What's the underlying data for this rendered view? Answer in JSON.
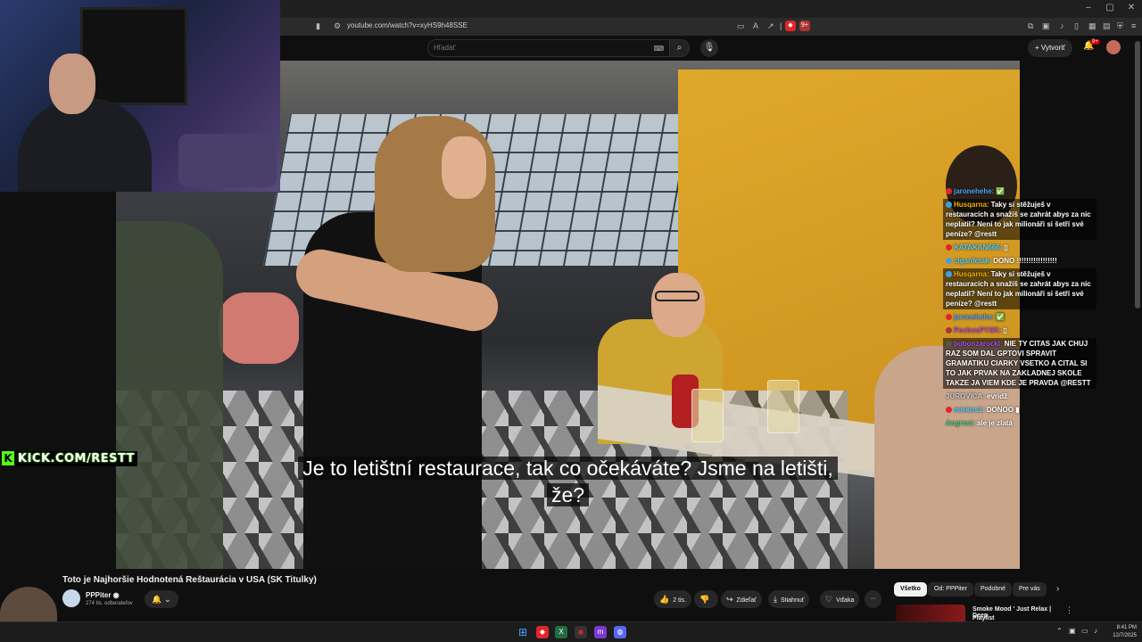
{
  "browser": {
    "url": "youtube.com/watch?v=xyHS9h48SSE",
    "notification_badge": "9+",
    "window_controls": [
      "–",
      "▢",
      "✕"
    ]
  },
  "youtube_header": {
    "search_placeholder": "Hľadať",
    "create_label": "Vytvoriť",
    "notification_count": "9+"
  },
  "video": {
    "subtitle_line1": "Je to letištní restaurace, tak co očekáváte? Jsme na letišti,",
    "subtitle_line2": "že?"
  },
  "overlay": {
    "kick_handle": "KICK.COM/RESTT",
    "kick_letter": "K"
  },
  "chat": [
    {
      "user": "jaronehehe:",
      "text": "✅",
      "user_color": "#4fa3ff",
      "badge_color": "#e0262c",
      "boxed": false
    },
    {
      "user": "Husqarna:",
      "text": "Taky si stěžuješ v restauracích a snažíš se zahrát abys za nic neplatil? Není to jak milionáři si šetří své peníze? @restt",
      "user_color": "#f0b400",
      "badge_color": "#3fa0e0",
      "boxed": true
    },
    {
      "user": "KATAKAN666:",
      "text": "▯",
      "user_color": "#56d3ff",
      "badge_color": "#e0262c",
      "boxed": false
    },
    {
      "user": "ciganfetak:",
      "text": "DONO !!!!!!!!!!!!!!!!!",
      "user_color": "#56d3ff",
      "badge_color": "#3fa0e0",
      "boxed": false
    },
    {
      "user": "Husqarna:",
      "text": "Taky si stěžuješ v restauracích a snažíš se zahrát abys za nic neplatil? Není to jak milionáři si šetří své peníze? @restt",
      "user_color": "#f0b400",
      "badge_color": "#3fa0e0",
      "boxed": true
    },
    {
      "user": "jaronehehe:",
      "text": "✅",
      "user_color": "#4fa3ff",
      "badge_color": "#e0262c",
      "boxed": false
    },
    {
      "user": "PochvoPYSK:",
      "text": "▯",
      "user_color": "#c04ad0",
      "badge_color": "#a33",
      "boxed": false
    },
    {
      "user": "bobonzarockl:",
      "text": "NIE TY CITAS JAK CHUJ RAZ SOM DAL GPTOVI SPRAVIT GRAMATIKU CIARKY VSETKO A CITAL SI TO JAK PRVAK NA ZAKLADNEJ SKOLE TAKZE JA VIEM KDE JE PRAVDA @RESTT",
      "user_color": "#a050ff",
      "badge_color": "#555",
      "boxed": true
    },
    {
      "user": "JUROVICA:",
      "text": "evridž",
      "user_color": "#cfcfcf",
      "badge_color": "",
      "boxed": false
    },
    {
      "user": "miskos1:",
      "text": "DONOO ▮",
      "user_color": "#56d3ff",
      "badge_color": "#e0262c",
      "boxed": false
    },
    {
      "user": "Angrest:",
      "text": "ale je zlatá",
      "user_color": "#3fd07a",
      "badge_color": "",
      "boxed": false
    }
  ],
  "video_info": {
    "title": "Toto je Najhoršie Hodnotená Reštaurácia v USA (SK Titulky)",
    "channel_name": "PPPiter ◉",
    "subscribers": "274 tis. odberateľov",
    "subscribe_bell": "🔔 ⌄",
    "likes": "2 tis.",
    "share": "Zdieľať",
    "download": "Stiahnuť",
    "thanks": "Vďaka",
    "more": "···"
  },
  "recommendations": {
    "chips": [
      "Všetko",
      "Od: PPPiter",
      "Podobné",
      "Pre vás"
    ],
    "active_chip": "Všetko",
    "first_title": "Smoke Mood ' Just Relax | Deep",
    "first_title_cut": "Playlist"
  },
  "taskbar": {
    "time": "8:41 PM",
    "date": "12/7/2025"
  },
  "colors": {
    "accent_red": "#cc0000",
    "kick_green": "#53fc18",
    "video_wall_yellow": "#e0a82b"
  }
}
